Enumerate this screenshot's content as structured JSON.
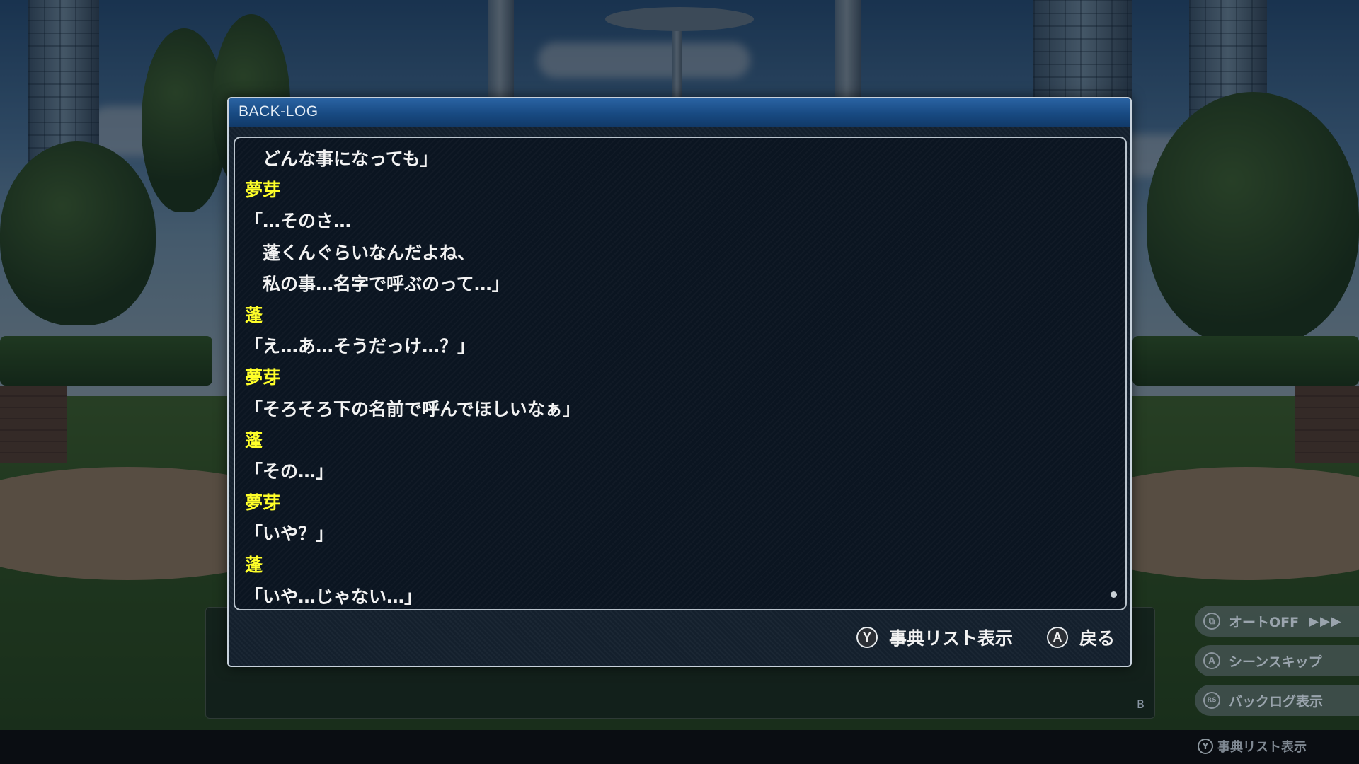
{
  "backlog": {
    "title": "BACK-LOG",
    "lines": [
      {
        "text": "　どんな事になっても」",
        "speaker": false
      },
      {
        "text": "夢芽",
        "speaker": true
      },
      {
        "text": "「…そのさ…",
        "speaker": false
      },
      {
        "text": "　蓬くんぐらいなんだよね、",
        "speaker": false
      },
      {
        "text": "　私の事…名字で呼ぶのって…」",
        "speaker": false
      },
      {
        "text": "蓬",
        "speaker": true
      },
      {
        "text": "「え…あ…そうだっけ…？」",
        "speaker": false
      },
      {
        "text": "夢芽",
        "speaker": true
      },
      {
        "text": "「そろそろ下の名前で呼んでほしいなぁ」",
        "speaker": false
      },
      {
        "text": "蓬",
        "speaker": true
      },
      {
        "text": "「その…」",
        "speaker": false
      },
      {
        "text": "夢芽",
        "speaker": true
      },
      {
        "text": "「いや？」",
        "speaker": false
      },
      {
        "text": "蓬",
        "speaker": true
      },
      {
        "text": "「いや…じゃない…」",
        "speaker": false
      }
    ],
    "footer": {
      "dictionary": {
        "button": "Y",
        "label": "事典リスト表示"
      },
      "back": {
        "button": "A",
        "label": "戻る"
      }
    }
  },
  "message_window": {
    "close_button": "B"
  },
  "side_menu": {
    "auto": {
      "label": "オートOFF",
      "icon": "auto-icon",
      "arrows": "▶▶▶"
    },
    "skip": {
      "label": "シーンスキップ",
      "button": "A"
    },
    "log": {
      "label": "バックログ表示",
      "button": "RS"
    }
  },
  "footer_hint": {
    "button": "Y",
    "label": "事典リスト表示"
  },
  "colors": {
    "speaker": "#ffff29",
    "header": "#1c4f8a",
    "text": "#f2f2f2"
  }
}
